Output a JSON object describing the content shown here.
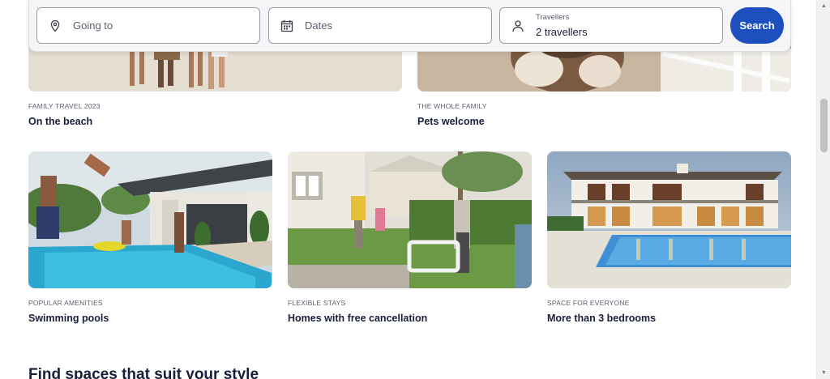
{
  "search": {
    "going_to_placeholder": "Going to",
    "dates_placeholder": "Dates",
    "travellers_label": "Travellers",
    "travellers_value": "2 travellers",
    "search_label": "Search"
  },
  "cards_top": [
    {
      "eyebrow": "FAMILY TRAVEL 2023",
      "title": "On the beach"
    },
    {
      "eyebrow": "THE WHOLE FAMILY",
      "title": "Pets welcome"
    }
  ],
  "cards_bottom": [
    {
      "eyebrow": "POPULAR AMENITIES",
      "title": "Swimming pools"
    },
    {
      "eyebrow": "FLEXIBLE STAYS",
      "title": "Homes with free cancellation"
    },
    {
      "eyebrow": "SPACE FOR EVERYONE",
      "title": "More than 3 bedrooms"
    }
  ],
  "section_title": "Find spaces that suit your style",
  "colors": {
    "search_button": "#1e4fbf",
    "text_primary": "#191e3b",
    "text_secondary": "#5d5f6e"
  }
}
